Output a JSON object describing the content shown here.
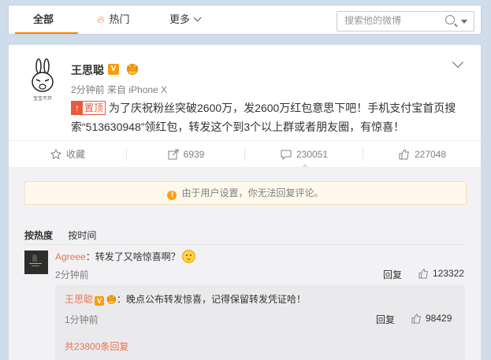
{
  "tabs": {
    "all": "全部",
    "hot": "热门",
    "more": "更多"
  },
  "search": {
    "placeholder": "搜索他的微博"
  },
  "post": {
    "author": "王思聪",
    "avatar_caption": "宝宝不开",
    "time": "2分钟前",
    "source": "来自 iPhone X",
    "top_tag": "置顶",
    "text": "为了庆祝粉丝突破2600万，发2600万红包意思下吧！手机支付宝首页搜索“513630948”领红包，转发这个到3个以上群或者朋友圈，有惊喜！"
  },
  "actions": {
    "favorite": "收藏",
    "repost": "6939",
    "comment": "230051",
    "like": "227048"
  },
  "comments_section": {
    "notice": "由于用户设置，你无法回复评论。",
    "sort_hot": "按热度",
    "sort_time": "按时间",
    "comment1": {
      "user": "Agreee",
      "text": "：转发了又啥惊喜啊？",
      "time": "2分钟前",
      "reply": "回复",
      "likes": "123322"
    },
    "comment2": {
      "user": "王思聪",
      "text": "：晚点公布转发惊喜，记得保留转发凭证哈！",
      "time": "1分钟前",
      "reply": "回复",
      "likes": "98429"
    },
    "more_replies": "共23800条回复"
  },
  "colors": {
    "accent": "#ff8200",
    "link": "#eb7350",
    "badge": "#f59e0b"
  }
}
